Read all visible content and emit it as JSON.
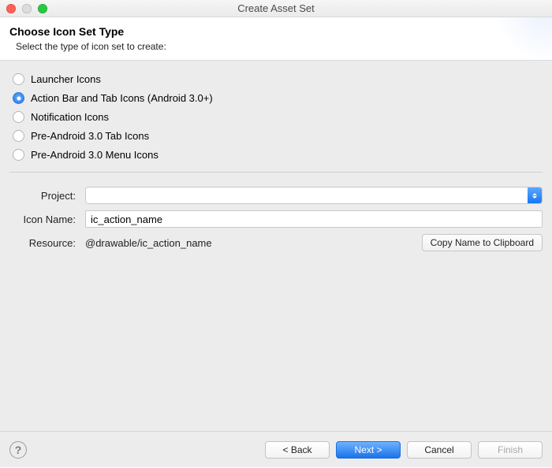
{
  "window": {
    "title": "Create Asset Set"
  },
  "header": {
    "title": "Choose Icon Set Type",
    "subtitle": "Select the type of icon set to create:"
  },
  "radios": {
    "selected_index": 1,
    "items": [
      {
        "label": "Launcher Icons"
      },
      {
        "label": "Action Bar and Tab Icons (Android 3.0+)"
      },
      {
        "label": "Notification Icons"
      },
      {
        "label": "Pre-Android 3.0 Tab Icons"
      },
      {
        "label": "Pre-Android 3.0 Menu Icons"
      }
    ]
  },
  "form": {
    "project_label": "Project:",
    "project_value": "",
    "icon_name_label": "Icon Name:",
    "icon_name_value": "ic_action_name",
    "resource_label": "Resource:",
    "resource_value": "@drawable/ic_action_name",
    "copy_button": "Copy Name to Clipboard"
  },
  "footer": {
    "back": "< Back",
    "next": "Next >",
    "cancel": "Cancel",
    "finish": "Finish"
  }
}
